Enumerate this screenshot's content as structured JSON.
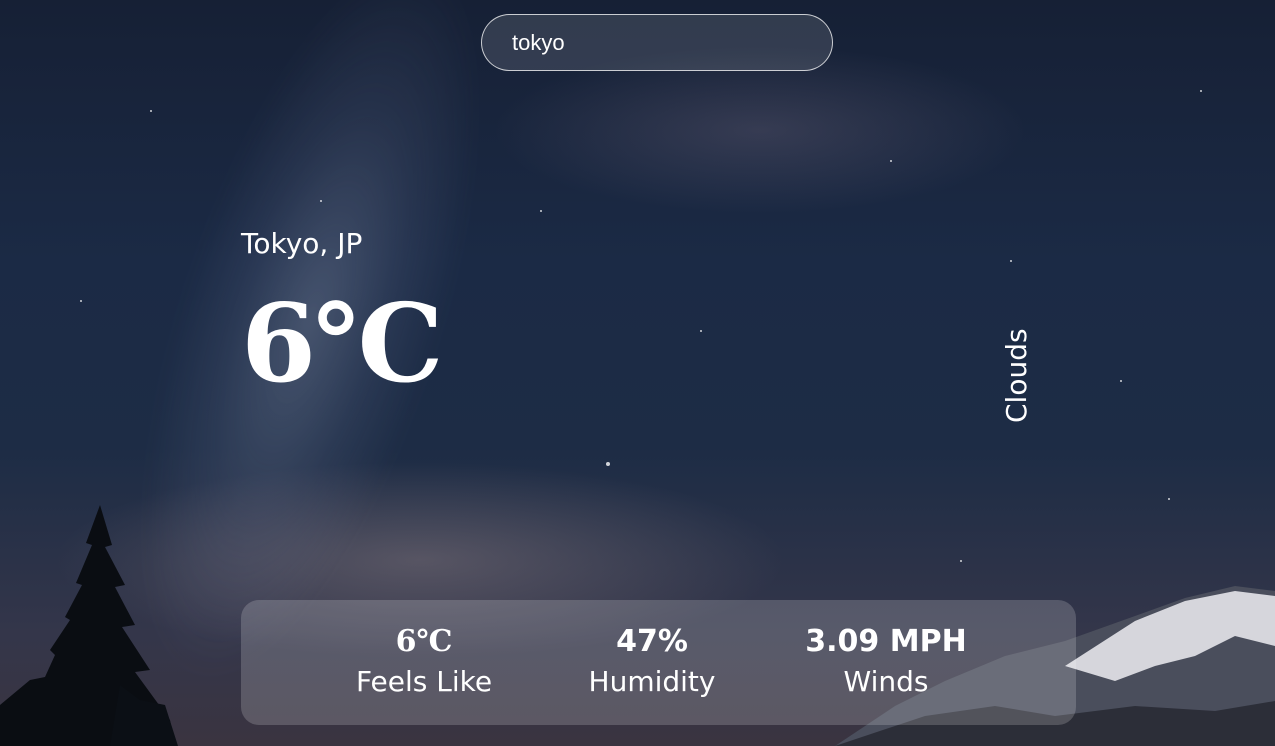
{
  "search": {
    "value": "tokyo"
  },
  "weather": {
    "location": "Tokyo, JP",
    "temperature": "6℃",
    "condition": "Clouds"
  },
  "stats": {
    "feels_like_value": "6℃",
    "feels_like_label": "Feels Like",
    "humidity_value": "47%",
    "humidity_label": "Humidity",
    "wind_value": "3.09 MPH",
    "wind_label": "Winds"
  }
}
